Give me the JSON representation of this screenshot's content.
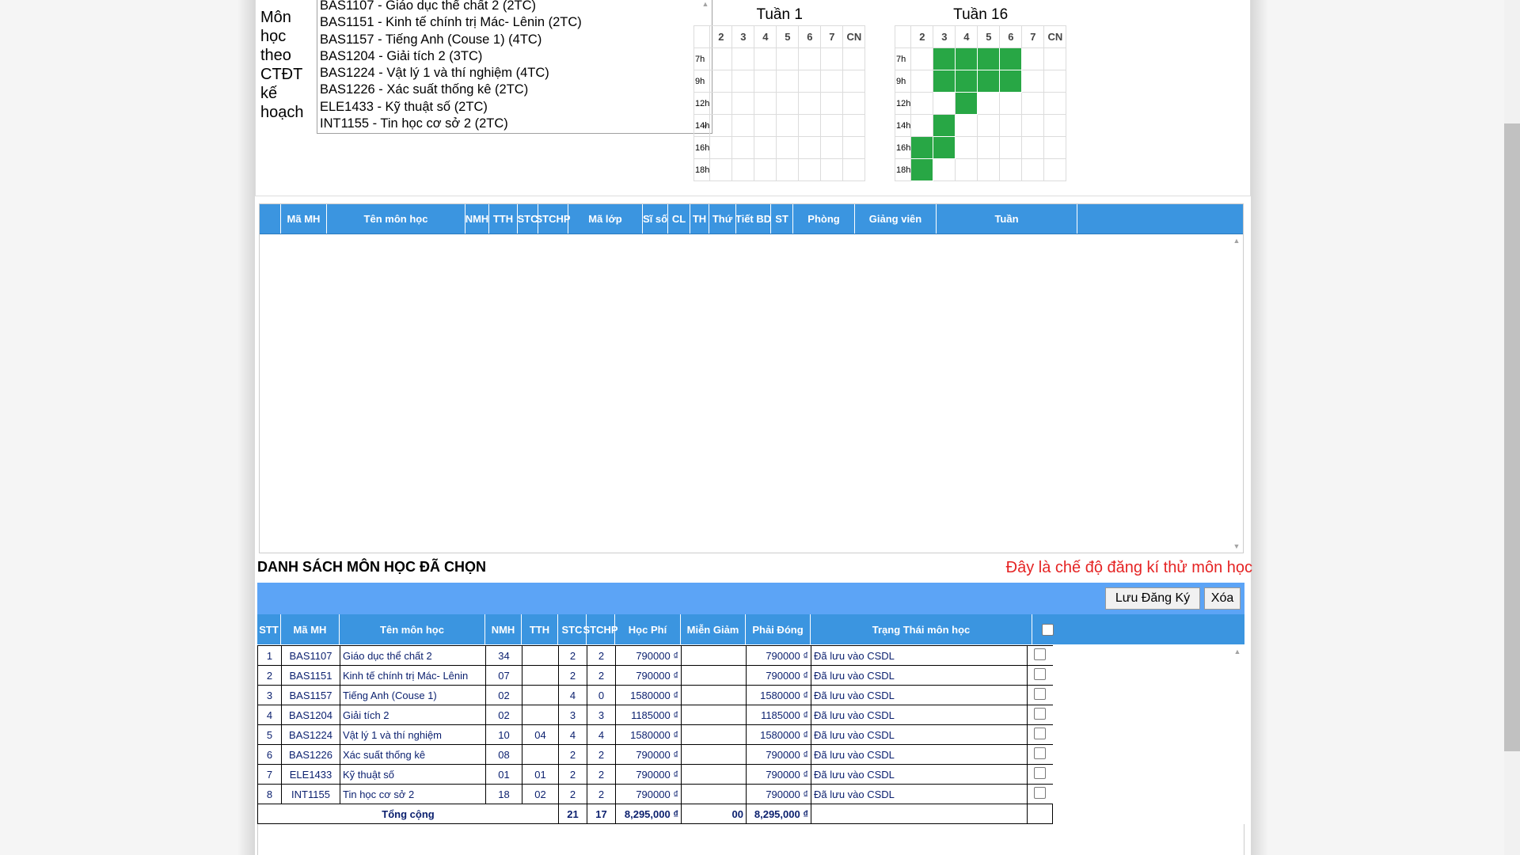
{
  "subject_label": "Môn học theo CTĐT kế hoạch",
  "subject_options": [
    "BAS1107 - Giáo dục thể chất 2 (2TC)",
    "BAS1151 - Kinh tế chính trị Mác- Lênin (2TC)",
    "BAS1157 - Tiếng Anh (Couse 1) (4TC)",
    "BAS1204 - Giải tích 2 (3TC)",
    "BAS1224 - Vật lý 1 và thí nghiệm (4TC)",
    "BAS1226 - Xác suất thống kê (2TC)",
    "ELE1433 - Kỹ thuật số (2TC)",
    "INT1155 - Tin học cơ sở 2 (2TC)"
  ],
  "weeks": [
    {
      "title": "Tuần 1",
      "days": [
        "2",
        "3",
        "4",
        "5",
        "6",
        "7",
        "CN"
      ],
      "hours": [
        "7h",
        "9h",
        "12h",
        "14h",
        "16h",
        "18h"
      ],
      "busy": []
    },
    {
      "title": "Tuần 16",
      "days": [
        "2",
        "3",
        "4",
        "5",
        "6",
        "7",
        "CN"
      ],
      "hours": [
        "7h",
        "9h",
        "12h",
        "14h",
        "16h",
        "18h"
      ],
      "busy": [
        [
          0,
          1
        ],
        [
          0,
          2
        ],
        [
          0,
          3
        ],
        [
          0,
          4
        ],
        [
          1,
          1
        ],
        [
          1,
          2
        ],
        [
          1,
          3
        ],
        [
          1,
          4
        ],
        [
          2,
          2
        ],
        [
          3,
          1
        ],
        [
          4,
          0
        ],
        [
          4,
          1
        ],
        [
          5,
          0
        ]
      ]
    }
  ],
  "class_table": {
    "columns": [
      "",
      "Mã MH",
      "Tên môn học",
      "NMH",
      "TTH",
      "STC",
      "STCHP",
      "Mã lớp",
      "Sĩ số",
      "CL",
      "TH",
      "Thứ",
      "Tiết BD",
      "ST",
      "Phòng",
      "Giảng viên",
      "Tuần"
    ]
  },
  "selected": {
    "title": "DANH SÁCH MÔN HỌC ĐÃ CHỌN",
    "trial_notice": "Đây là chế độ đăng kí thử môn học",
    "save_label": "Lưu Đăng Ký",
    "delete_label": "Xóa",
    "columns": [
      "STT",
      "Mã MH",
      "Tên môn học",
      "NMH",
      "TTH",
      "STC",
      "STCHP",
      "Học Phí",
      "Miễn Giảm",
      "Phải Đóng",
      "Trạng Thái môn học"
    ],
    "rows": [
      {
        "stt": "1",
        "code": "BAS1107",
        "name": "Giáo dục thể chất 2",
        "nmh": "34",
        "tth": "",
        "stc": "2",
        "stchp": "2",
        "fee": "790000 ₫",
        "discount": "",
        "due": "790000 ₫",
        "status": "Đã lưu vào CSDL"
      },
      {
        "stt": "2",
        "code": "BAS1151",
        "name": "Kinh tế chính trị Mác- Lênin",
        "nmh": "07",
        "tth": "",
        "stc": "2",
        "stchp": "2",
        "fee": "790000 ₫",
        "discount": "",
        "due": "790000 ₫",
        "status": "Đã lưu vào CSDL"
      },
      {
        "stt": "3",
        "code": "BAS1157",
        "name": "Tiếng Anh (Couse 1)",
        "nmh": "02",
        "tth": "",
        "stc": "4",
        "stchp": "0",
        "fee": "1580000 ₫",
        "discount": "",
        "due": "1580000 ₫",
        "status": "Đã lưu vào CSDL"
      },
      {
        "stt": "4",
        "code": "BAS1204",
        "name": "Giải tích 2",
        "nmh": "02",
        "tth": "",
        "stc": "3",
        "stchp": "3",
        "fee": "1185000 ₫",
        "discount": "",
        "due": "1185000 ₫",
        "status": "Đã lưu vào CSDL"
      },
      {
        "stt": "5",
        "code": "BAS1224",
        "name": "Vật lý 1 và thí nghiệm",
        "nmh": "10",
        "tth": "04",
        "stc": "4",
        "stchp": "4",
        "fee": "1580000 ₫",
        "discount": "",
        "due": "1580000 ₫",
        "status": "Đã lưu vào CSDL"
      },
      {
        "stt": "6",
        "code": "BAS1226",
        "name": "Xác suất thống kê",
        "nmh": "08",
        "tth": "",
        "stc": "2",
        "stchp": "2",
        "fee": "790000 ₫",
        "discount": "",
        "due": "790000 ₫",
        "status": "Đã lưu vào CSDL"
      },
      {
        "stt": "7",
        "code": "ELE1433",
        "name": "Kỹ thuật số",
        "nmh": "01",
        "tth": "01",
        "stc": "2",
        "stchp": "2",
        "fee": "790000 ₫",
        "discount": "",
        "due": "790000 ₫",
        "status": "Đã lưu vào CSDL"
      },
      {
        "stt": "8",
        "code": "INT1155",
        "name": "Tin học cơ sở 2",
        "nmh": "18",
        "tth": "02",
        "stc": "2",
        "stchp": "2",
        "fee": "790000 ₫",
        "discount": "",
        "due": "790000 ₫",
        "status": "Đã lưu vào CSDL"
      }
    ],
    "total": {
      "label": "Tổng cộng",
      "stc": "21",
      "stchp": "17",
      "fee": "8,295,000 ₫",
      "discount": "00",
      "due": "8,295,000 ₫"
    }
  },
  "colors": {
    "header_blue": "#3b95e0",
    "toolbar_blue": "#5ca4f6",
    "busy_green": "#28a745",
    "notice_red": "#e52323",
    "cell_text": "#0a1f6e"
  }
}
